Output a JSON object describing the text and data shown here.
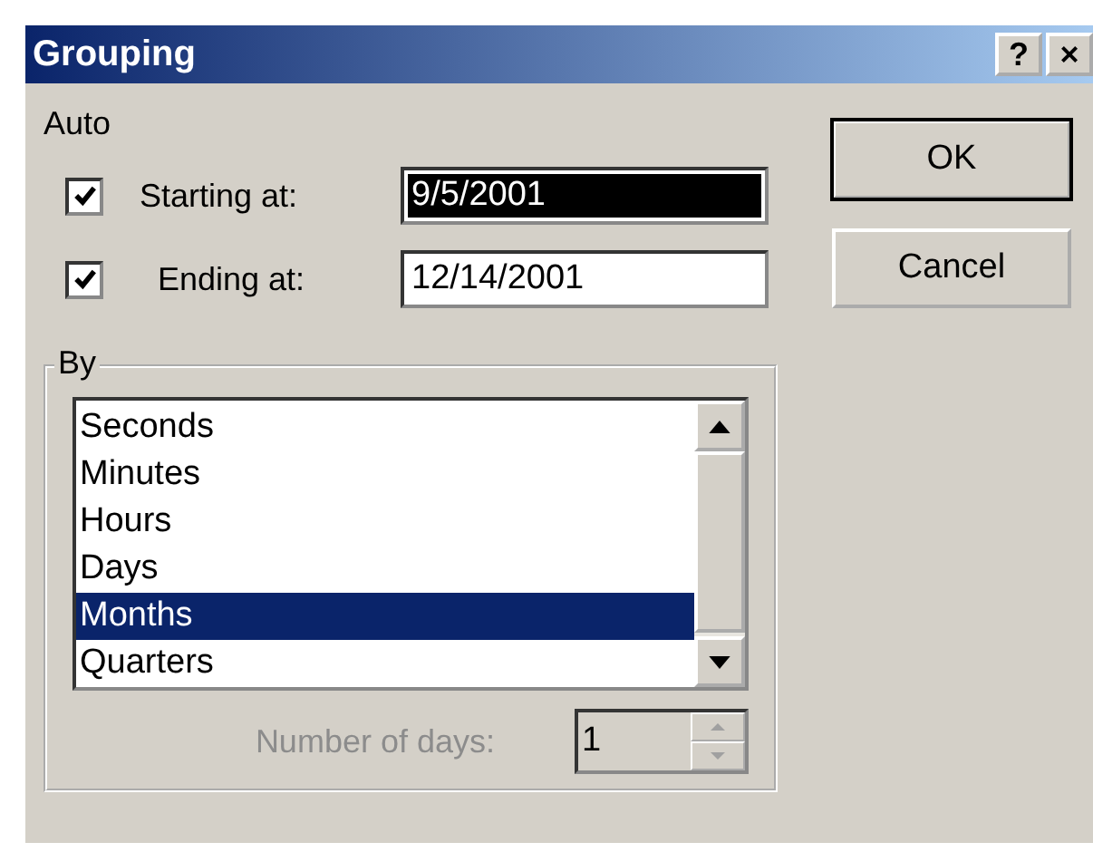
{
  "window": {
    "title": "Grouping",
    "title_buttons": [
      "?",
      "×"
    ]
  },
  "auto": {
    "label": "Auto",
    "rows": [
      {
        "checked": true,
        "label": "Starting at:",
        "value": "9/5/2001",
        "selected": true
      },
      {
        "checked": true,
        "label": "Ending at:",
        "value": "12/14/2001",
        "selected": false
      }
    ]
  },
  "buttons": [
    "OK",
    "Cancel"
  ],
  "by": {
    "label": "By",
    "items": [
      {
        "label": "Seconds",
        "selected": false
      },
      {
        "label": "Minutes",
        "selected": false
      },
      {
        "label": "Hours",
        "selected": false
      },
      {
        "label": "Days",
        "selected": false
      },
      {
        "label": "Months",
        "selected": true
      },
      {
        "label": "Quarters",
        "selected": false
      }
    ],
    "days": {
      "label": "Number of days:",
      "value": "1",
      "disabled": true
    }
  }
}
